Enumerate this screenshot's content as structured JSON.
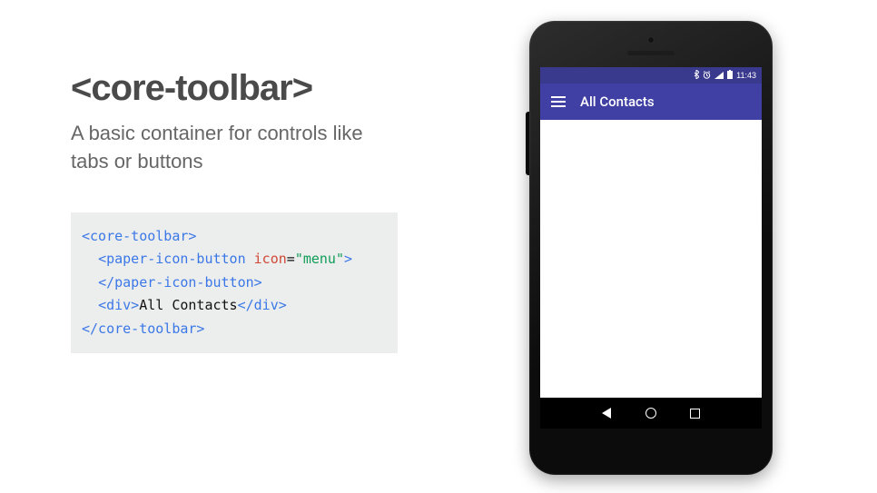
{
  "heading": "<core-toolbar>",
  "subheading": "A basic container for controls like tabs or buttons",
  "code": {
    "l1_open": "<core-toolbar>",
    "l2_open_tag": "<paper-icon-button",
    "l2_attr_name": " icon",
    "l2_eq": "=",
    "l2_attr_val": "\"menu\"",
    "l2_close": ">",
    "l3": "</paper-icon-button>",
    "l4_open": "<div>",
    "l4_text": "All Contacts",
    "l4_close": "</div>",
    "l5": "</core-toolbar>"
  },
  "phone": {
    "status": {
      "bt_icon": "bluetooth-icon",
      "alarm_icon": "alarm-icon",
      "signal_icon": "signal-icon",
      "battery_icon": "battery-icon",
      "clock": "11:43"
    },
    "toolbar": {
      "menu_icon": "menu-icon",
      "title": "All Contacts"
    },
    "nav": {
      "back": "back-icon",
      "home": "home-icon",
      "recent": "recent-icon"
    }
  }
}
